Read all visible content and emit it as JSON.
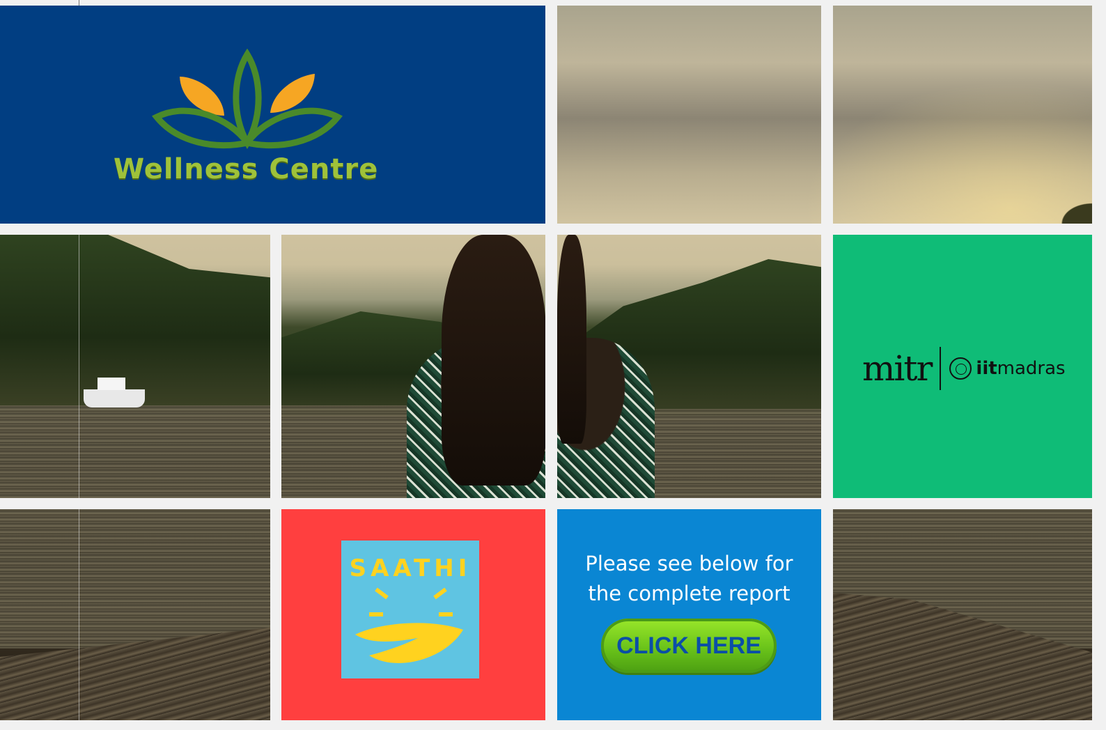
{
  "wellness": {
    "title": "Wellness Centre",
    "bg": "#013e82",
    "leaf_orange": "#f6a623",
    "leaf_green": "#4a8a2a"
  },
  "mitr": {
    "brand": "mitr",
    "partner_bold": "iit",
    "partner_rest": "madras",
    "bg": "#0fbc77",
    "icon": "iit-madras-seal-icon"
  },
  "saathi": {
    "label": "SAATHI",
    "bg": "#ff3f3f",
    "card_bg": "#5fc4e2",
    "accent": "#ffd21f",
    "icon": "sun-hands-icon"
  },
  "report": {
    "line1": "Please see below for",
    "line2": "the complete report",
    "button_label": "CLICK HERE",
    "bg": "#0a86d3"
  },
  "photo": {
    "icon": "lakeside-woman-photo"
  }
}
